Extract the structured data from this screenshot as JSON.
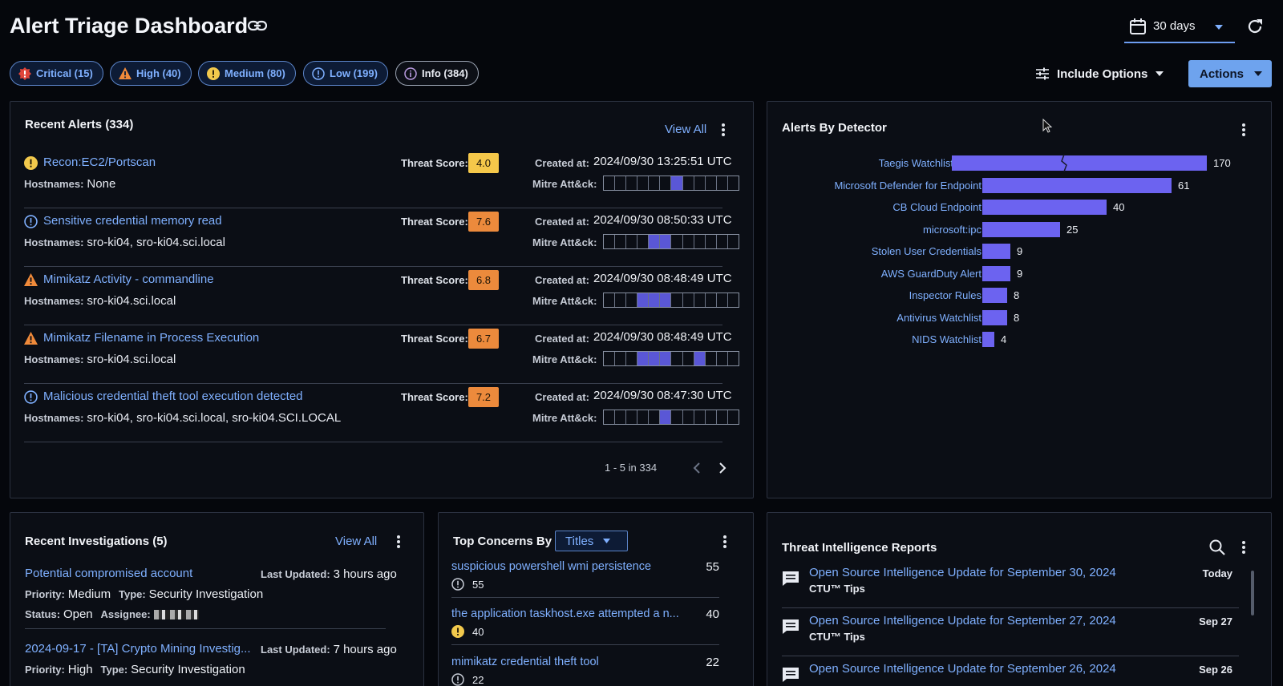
{
  "header": {
    "title": "Alert Triage Dashboard",
    "range_label": "30 days",
    "include_options_label": "Include Options",
    "actions_label": "Actions"
  },
  "severity_chips": [
    {
      "label": "Critical (15)",
      "icon": "critical-icon",
      "color": "#e0453a"
    },
    {
      "label": "High (40)",
      "icon": "warning-triangle-icon",
      "color": "#f08a3a"
    },
    {
      "label": "Medium (80)",
      "icon": "medium-circle-icon",
      "color": "#f2c94c"
    },
    {
      "label": "Low (199)",
      "icon": "low-circle-icon",
      "color": "#7fb0ff"
    },
    {
      "label": "Info (384)",
      "icon": "info-circle-icon",
      "color": "#b99be0"
    }
  ],
  "recent_alerts": {
    "title": "Recent Alerts (334)",
    "view_all": "View All",
    "threat_score_label": "Threat Score:",
    "created_label": "Created at:",
    "mitre_label": "Mitre Att&ck:",
    "hostnames_label": "Hostnames:",
    "pagination": "1 - 5 in 334",
    "items": [
      {
        "name": "Recon:EC2/Portscan",
        "severity": "medium",
        "hostnames": "None",
        "score": "4.0",
        "score_color": "#f5c84a",
        "created": "2024/09/30 13:25:51 UTC",
        "mitre": [
          0,
          0,
          0,
          0,
          0,
          0,
          1,
          0,
          0,
          0,
          0,
          0
        ]
      },
      {
        "name": "Sensitive credential memory read",
        "severity": "low",
        "hostnames": "sro-ki04, sro-ki04.sci.local",
        "score": "7.6",
        "score_color": "#ec8a3c",
        "created": "2024/09/30 08:50:33 UTC",
        "mitre": [
          0,
          0,
          0,
          0,
          1,
          1,
          0,
          0,
          0,
          0,
          0,
          0
        ]
      },
      {
        "name": "Mimikatz Activity - commandline",
        "severity": "high",
        "hostnames": "sro-ki04.sci.local",
        "score": "6.8",
        "score_color": "#ec8a3c",
        "created": "2024/09/30 08:48:49 UTC",
        "mitre": [
          0,
          0,
          0,
          1,
          1,
          1,
          0,
          0,
          0,
          0,
          0,
          0
        ]
      },
      {
        "name": "Mimikatz Filename in Process Execution",
        "severity": "high",
        "hostnames": "sro-ki04.sci.local",
        "score": "6.7",
        "score_color": "#ec8a3c",
        "created": "2024/09/30 08:48:49 UTC",
        "mitre": [
          0,
          0,
          0,
          1,
          1,
          1,
          0,
          0,
          1,
          0,
          0,
          0
        ]
      },
      {
        "name": "Malicious credential theft tool execution detected",
        "severity": "low",
        "hostnames": "sro-ki04, sro-ki04.sci.local, sro-ki04.SCI.LOCAL",
        "score": "7.2",
        "score_color": "#ec8a3c",
        "created": "2024/09/30 08:47:30 UTC",
        "mitre": [
          0,
          0,
          0,
          0,
          0,
          1,
          0,
          0,
          0,
          0,
          0,
          0
        ]
      }
    ]
  },
  "alerts_by_detector": {
    "title": "Alerts By Detector",
    "chart_data": {
      "type": "bar",
      "orientation": "horizontal",
      "categories": [
        "Taegis Watchlist",
        "Microsoft Defender for Endpoint",
        "CB Cloud Endpoint",
        "microsoft:ipc",
        "Stolen User Credentials",
        "AWS GuardDuty Alert",
        "Inspector Rules",
        "Antivirus Watchlist",
        "NIDS Watchlist"
      ],
      "values": [
        170,
        61,
        40,
        25,
        9,
        9,
        8,
        8,
        4
      ],
      "axis_break": true,
      "bar_color": "#6c63f0"
    }
  },
  "recent_investigations": {
    "title": "Recent Investigations (5)",
    "view_all": "View All",
    "last_updated_label": "Last Updated:",
    "priority_label": "Priority:",
    "type_label": "Type:",
    "status_label": "Status:",
    "assignee_label": "Assignee:",
    "items": [
      {
        "name": "Potential compromised account",
        "last_updated": "3 hours ago",
        "priority": "Medium",
        "type": "Security Investigation",
        "status": "Open"
      },
      {
        "name": "2024-09-17 - [TA] Crypto Mining Investig...",
        "last_updated": "7 hours ago",
        "priority": "High",
        "type": "Security Investigation"
      }
    ]
  },
  "top_concerns": {
    "title": "Top Concerns By",
    "select_value": "Titles",
    "items": [
      {
        "name": "suspicious powershell wmi persistence",
        "count": "55",
        "sub_count": "55",
        "sev": "low"
      },
      {
        "name": "the application taskhost.exe attempted a n...",
        "count": "40",
        "sub_count": "40",
        "sev": "medium"
      },
      {
        "name": "mimikatz credential theft tool",
        "count": "22",
        "sub_count": "22",
        "sev": "low"
      }
    ]
  },
  "threat_intel": {
    "title": "Threat Intelligence Reports",
    "items": [
      {
        "title": "Open Source Intelligence Update for September 30, 2024",
        "source": "CTU™ Tips",
        "date": "Today"
      },
      {
        "title": "Open Source Intelligence Update for September 27, 2024",
        "source": "CTU™ Tips",
        "date": "Sep 27"
      },
      {
        "title": "Open Source Intelligence Update for September 26, 2024",
        "source": "",
        "date": "Sep 26"
      }
    ]
  }
}
